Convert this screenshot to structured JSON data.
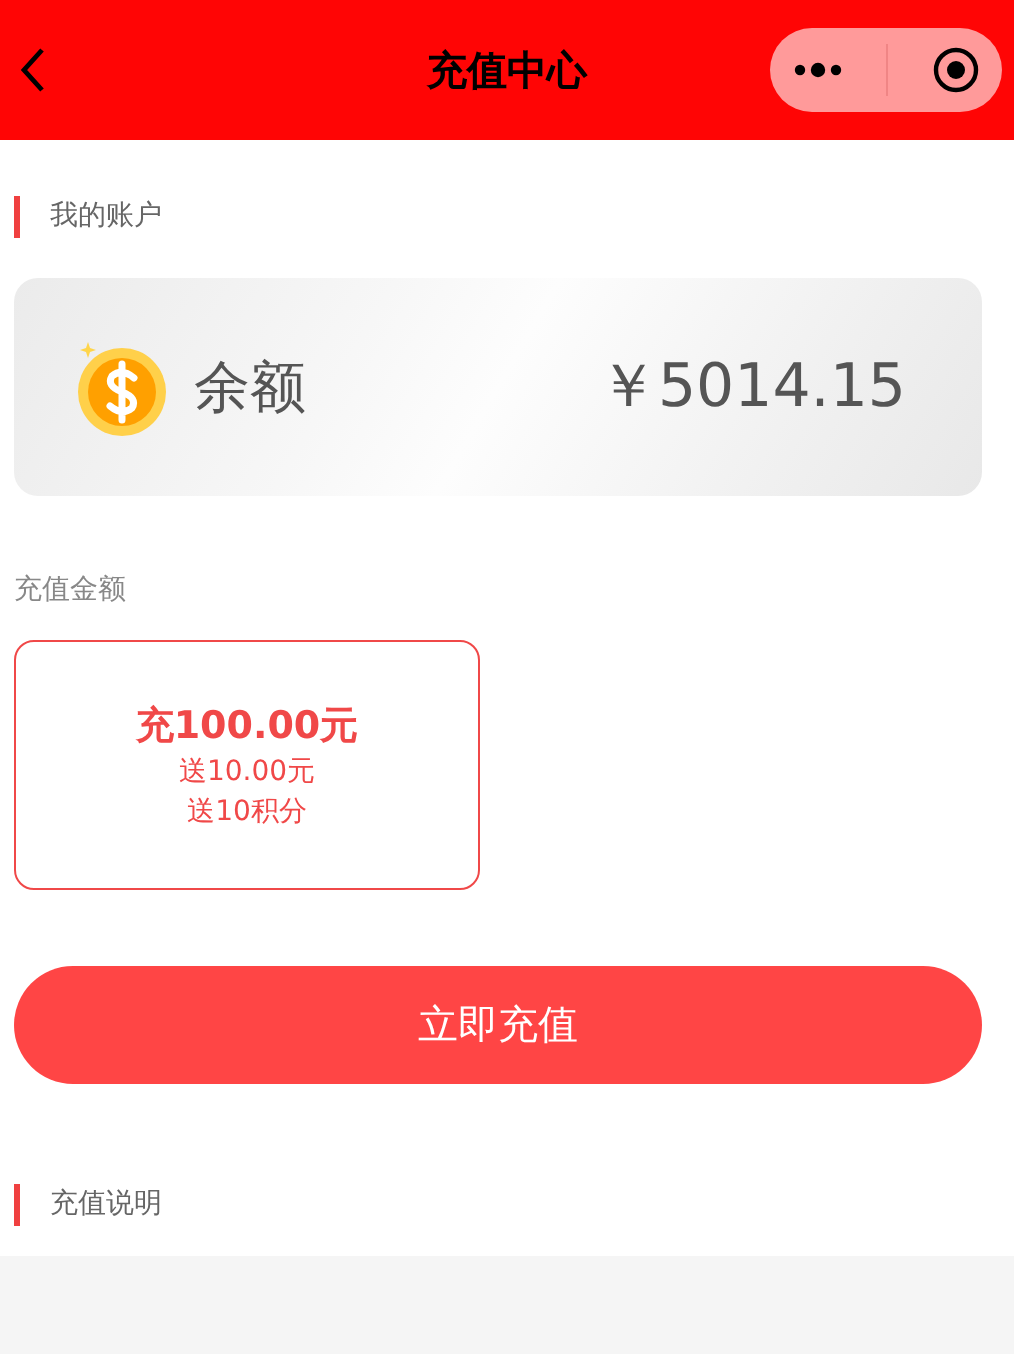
{
  "nav_bar": {
    "title": "充值中心"
  },
  "account_section": {
    "heading": "我的账户"
  },
  "balance_card": {
    "label": "余额",
    "amount": "￥5014.15"
  },
  "amount_section": {
    "heading": "充值金额"
  },
  "packages": [
    {
      "title": "充100.00元",
      "bonus": "送10.00元",
      "points": "送10积分",
      "selected": true
    }
  ],
  "recharge_button": "立即充值",
  "notes_section": {
    "heading": "充值说明"
  }
}
